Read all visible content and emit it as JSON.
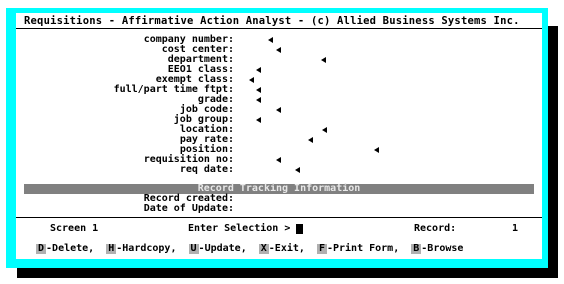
{
  "window": {
    "title": "Requisitions - Affirmative Action Analyst - (c) Allied Business Systems Inc."
  },
  "fields": [
    {
      "label": "company number:"
    },
    {
      "label": "cost center:"
    },
    {
      "label": "department:"
    },
    {
      "label": "EEO1 class:"
    },
    {
      "label": "exempt class:"
    },
    {
      "label": "full/part time ftpt:"
    },
    {
      "label": "grade:"
    },
    {
      "label": "job code:"
    },
    {
      "label": "job group:"
    },
    {
      "label": "location:"
    },
    {
      "label": "pay rate:"
    },
    {
      "label": "position:"
    },
    {
      "label": "requisition no:"
    },
    {
      "label": "req date:"
    }
  ],
  "tracking": {
    "header": "Record Tracking Information",
    "record_created_label": "Record created:",
    "date_of_update_label": "Date of Update:"
  },
  "status": {
    "screen_label": "Screen 1",
    "prompt": "Enter Selection >",
    "record_label": "Record:",
    "record_value": "1"
  },
  "commands": [
    {
      "key": "D",
      "label": "-Delete,"
    },
    {
      "key": "H",
      "label": "-Hardcopy,"
    },
    {
      "key": "U",
      "label": "-Update,"
    },
    {
      "key": "X",
      "label": "-Exit,"
    },
    {
      "key": "F",
      "label": "-Print Form,"
    },
    {
      "key": "B",
      "label": "-Browse"
    }
  ],
  "colors": {
    "frame": "#00ffff",
    "screen": "#ffffff",
    "bar": "#808080",
    "key": "#b0b0b0"
  }
}
